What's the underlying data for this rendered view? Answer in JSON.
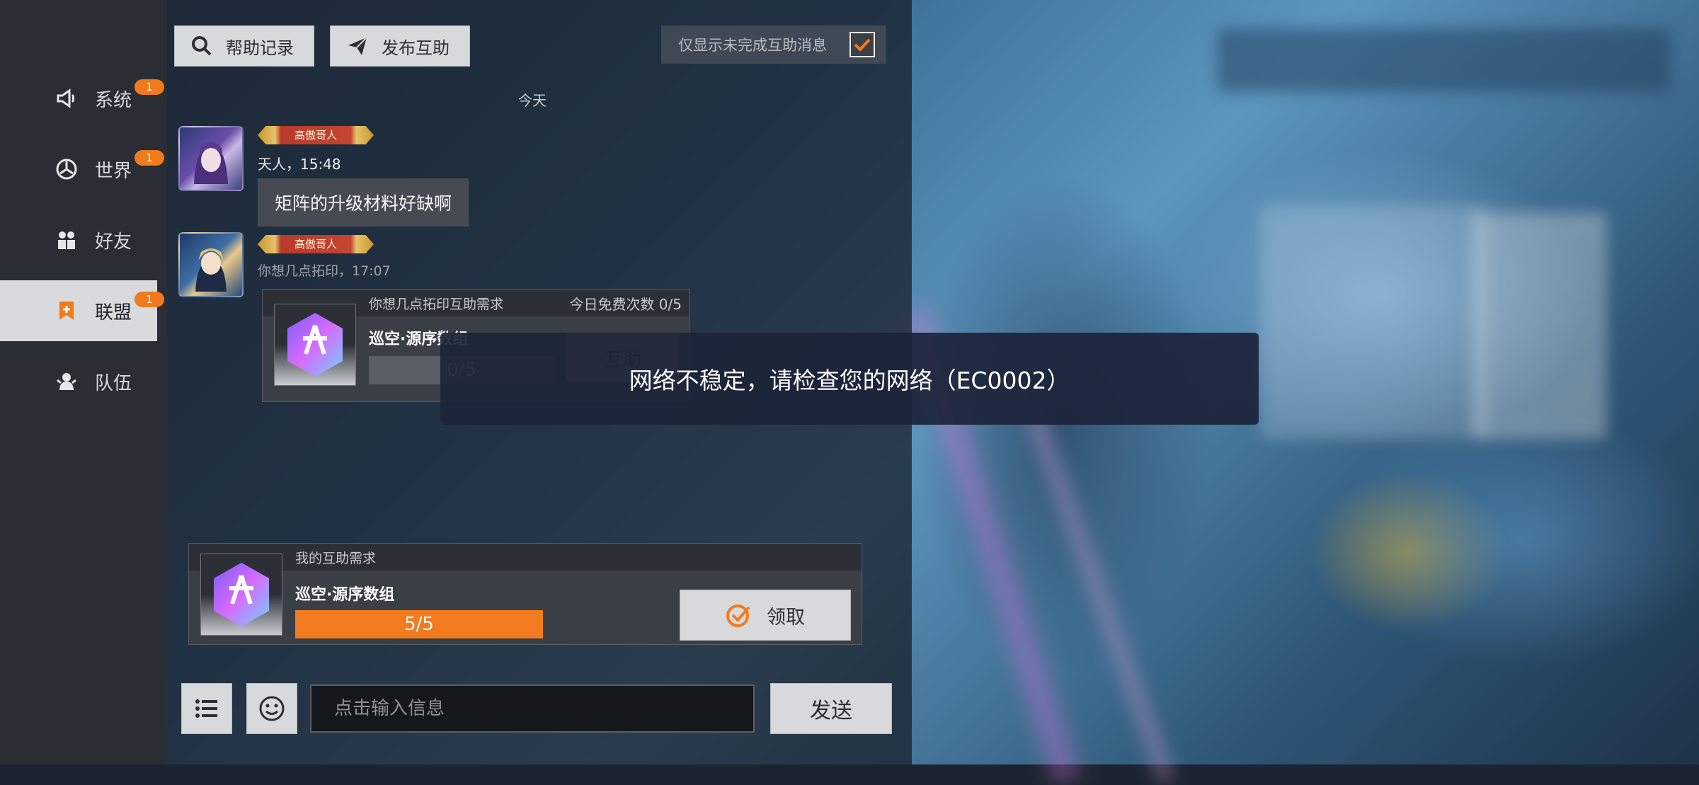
{
  "sidebar": {
    "items": [
      {
        "label": "系统",
        "badge": "1",
        "icon": "megaphone-icon"
      },
      {
        "label": "世界",
        "badge": "1",
        "icon": "compass-icon"
      },
      {
        "label": "好友",
        "badge": "",
        "icon": "friends-icon"
      },
      {
        "label": "联盟",
        "badge": "1",
        "icon": "alliance-flag-icon",
        "active": true
      },
      {
        "label": "队伍",
        "badge": "",
        "icon": "team-icon"
      }
    ]
  },
  "toolbar": {
    "help_record": "帮助记录",
    "publish_help": "发布互助",
    "filter_label": "仅显示未完成互助消息",
    "filter_checked": true
  },
  "chat": {
    "date_separator": "今天",
    "messages": [
      {
        "title_badge": "高傲哥人",
        "sender_line": "天人，15:48",
        "text": "矩阵的升级材料好缺啊"
      },
      {
        "title_badge": "高傲哥人",
        "sender_line": "你想几点拓印，17:07",
        "help_card": {
          "header": "你想几点拓印互助需求",
          "free_count": "今日免费次数 0/5",
          "item_name": "巡空·源序数组",
          "progress_text": "0/5",
          "progress": 0,
          "button": "互助"
        }
      }
    ]
  },
  "toast": {
    "message": "网络不稳定，请检查您的网络（EC0002）"
  },
  "my_request": {
    "header": "我的互助需求",
    "item_name": "巡空·源序数组",
    "progress_text": "5/5",
    "progress": 1.0,
    "claim_button": "领取"
  },
  "input_bar": {
    "placeholder": "点击输入信息",
    "send": "发送"
  },
  "colors": {
    "accent": "#f27b1f",
    "badge": "#f07b1d"
  }
}
